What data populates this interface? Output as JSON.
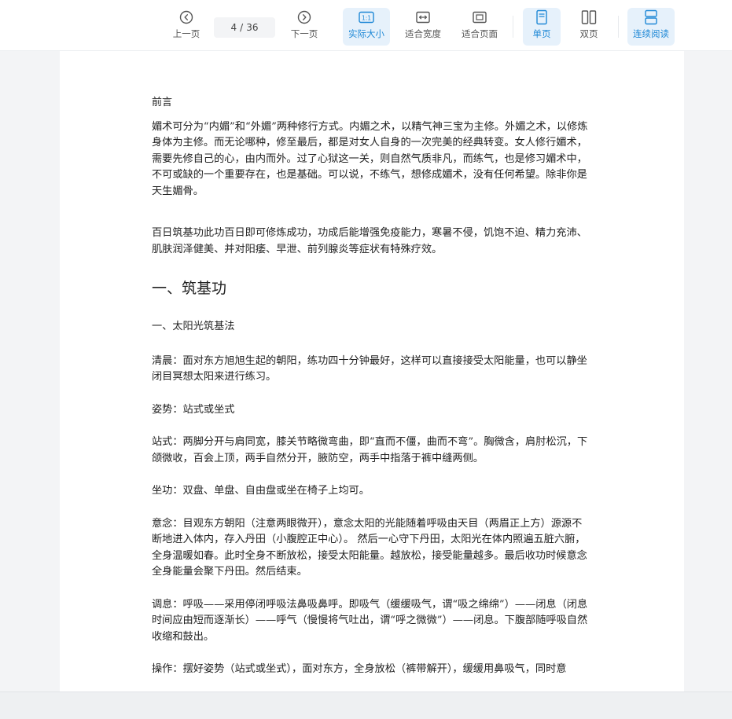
{
  "toolbar": {
    "prev_label": "上一页",
    "current_page": "4",
    "page_sep": "/",
    "total_pages": "36",
    "next_label": "下一页",
    "actual_size_label": "实际大小",
    "fit_width_label": "适合宽度",
    "fit_page_label": "适合页面",
    "single_page_label": "单页",
    "double_page_label": "双页",
    "continuous_label": "连续阅读",
    "accent_color": "#1e88d6",
    "active_bg": "#e6f1fb"
  },
  "document": {
    "preface_title": "前言",
    "para1": "媚术可分为“内媚”和“外媚”两种修行方式。内媚之术，以精气神三宝为主修。外媚之术，以修炼身体为主修。而无论哪种，修至最后，都是对女人自身的一次完美的经典转变。女人修行媚术，需要先修自己的心，由内而外。过了心狱这一关，则自然气质非凡，而练气，也是修习媚术中，不可或缺的一个重要存在，也是基础。可以说，不练气，想修成媚术，没有任何希望。除非你是天生媚骨。",
    "para2": "百日筑基功此功百日即可修炼成功，功成后能增强免疫能力，寒暑不侵，饥饱不迫、精力充沛、肌肤润泽健美、并对阳痿、早泄、前列腺炎等症状有特殊疗效。",
    "section_title": "一、筑基功",
    "sub_title": "一、太阳光筑基法",
    "para_morning": "清晨：面对东方旭旭生起的朝阳，练功四十分钟最好，这样可以直接接受太阳能量，也可以静坐闭目冥想太阳来进行练习。",
    "para_posture": "姿势：站式或坐式",
    "para_stand": "站式：两脚分开与肩同宽，膝关节略微弯曲，即“直而不僵，曲而不弯”。胸微含，肩肘松沉，下颌微收，百会上顶，两手自然分开，腋防空，两手中指落于裤中缝两侧。",
    "para_sit": "坐功：双盘、单盘、自由盘或坐在椅子上均可。",
    "para_mind": "意念：目观东方朝阳（注意两眼微开），意念太阳的光能随着呼吸由天目（两眉正上方）源源不断地进入体内，存入丹田（小腹腔正中心）。 然后一心守下丹田，太阳光在体内照遍五脏六腑，全身温暖如春。此时全身不断放松，接受太阳能量。越放松，接受能量越多。最后收功时候意念全身能量会聚下丹田。然后结束。",
    "para_breath": "调息：呼吸——采用停闭呼吸法鼻吸鼻呼。即吸气（缓缓吸气，谓“吸之绵绵”）——闭息（闭息时间应由短而逐渐长）——呼气（慢慢将气吐出，谓“呼之微微”）——闭息。下腹部随呼吸自然收缩和鼓出。",
    "para_operate": "操作：摆好姿势（站式或坐式），面对东方，全身放松（裤带解开），缓缓用鼻吸气，同时意"
  }
}
